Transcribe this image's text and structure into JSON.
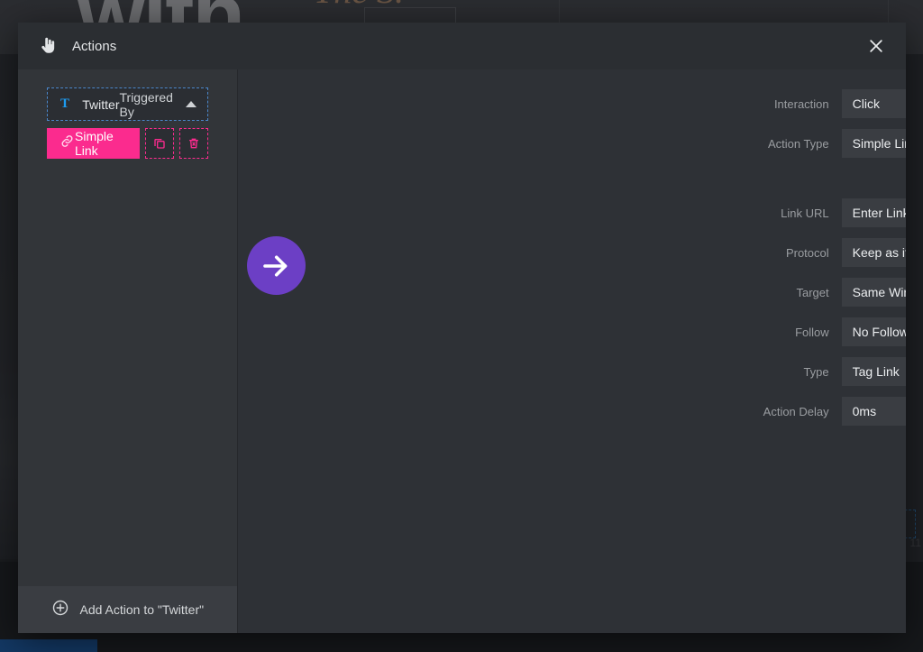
{
  "background": {
    "hero_word": "with",
    "script_text": "The S.",
    "side_number": "11"
  },
  "modal": {
    "header": {
      "icon": "hand-pointer-icon",
      "title": "Actions",
      "close_icon": "close-icon"
    },
    "left_panel": {
      "group": {
        "icon": "twitter-icon",
        "icon_glyph": "T",
        "name": "Twitter",
        "trigger_label": "Triggered By",
        "collapse_icon": "chevron-up-icon"
      },
      "action": {
        "icon": "link-icon",
        "label": "Simple Link",
        "duplicate_icon": "duplicate-icon",
        "delete_icon": "trash-icon"
      },
      "footer": {
        "icon": "plus-circle-icon",
        "label": "Add Action to \"Twitter\""
      }
    },
    "right_panel": {
      "badge_icon": "arrow-right-icon",
      "fields": [
        {
          "label": "Interaction",
          "value": "Click",
          "control": "select"
        },
        {
          "label": "Action Type",
          "value": "Simple Link",
          "control": "menu"
        },
        {
          "label": "Link URL",
          "value": "Enter Link",
          "control": "text"
        },
        {
          "label": "Protocol",
          "value": "Keep as it is",
          "control": "select"
        },
        {
          "label": "Target",
          "value": "Same Window",
          "control": "select"
        },
        {
          "label": "Follow",
          "value": "No Follow",
          "control": "select"
        },
        {
          "label": "Type",
          "value": "Tag Link",
          "control": "select"
        },
        {
          "label": "Action Delay",
          "value": "0ms",
          "control": "text"
        }
      ]
    }
  },
  "colors": {
    "accent_pink": "#fb2b8e",
    "accent_purple": "#6c3fc5",
    "twitter_blue": "#1d9bf0",
    "panel_left": "#323539",
    "panel_right": "#2e3136",
    "field_bg": "#3a3d42"
  }
}
